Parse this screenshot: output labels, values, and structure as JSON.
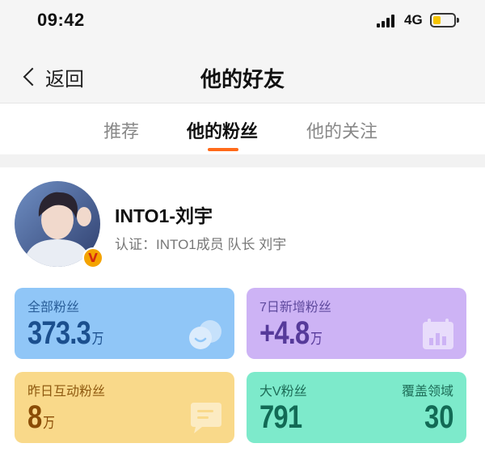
{
  "status_bar": {
    "time": "09:42",
    "network": "4G"
  },
  "nav": {
    "back_label": "返回",
    "title": "他的好友"
  },
  "tabs": [
    {
      "label": "推荐",
      "active": false
    },
    {
      "label": "他的粉丝",
      "active": true
    },
    {
      "label": "他的关注",
      "active": false
    }
  ],
  "colors": {
    "accent": "#ff6a1a",
    "card_blue": "#90c6f7",
    "card_purple": "#cdb3f5",
    "card_yellow": "#f9d98a",
    "card_green": "#7deacb"
  },
  "profile": {
    "name": "INTO1-刘宇",
    "verification": "认证：INTO1成员 队长 刘宇",
    "badge": "V"
  },
  "stats": {
    "total_fans": {
      "label": "全部粉丝",
      "value": "373.3",
      "unit": "万",
      "icon": "smiley-faces-icon"
    },
    "new_fans_7d": {
      "label": "7日新增粉丝",
      "value": "+4.8",
      "unit": "万",
      "icon": "calendar-chart-icon"
    },
    "interactive_fans": {
      "label": "昨日互动粉丝",
      "value": "8",
      "unit": "万",
      "icon": "chat-bubble-icon"
    },
    "bigv_fans": {
      "label": "大V粉丝",
      "value": "791",
      "right_label": "覆盖领域",
      "right_value": "30"
    }
  }
}
